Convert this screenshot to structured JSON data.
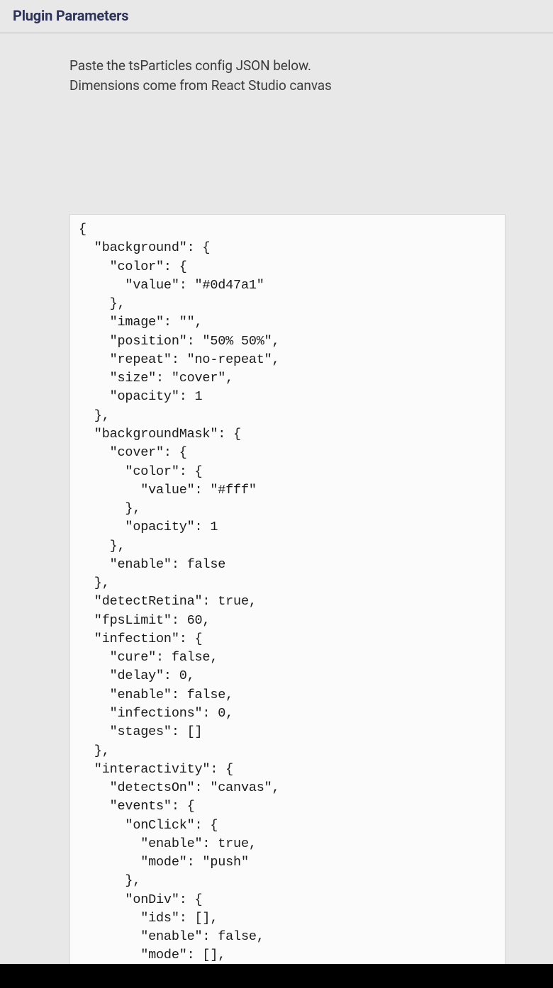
{
  "header": {
    "title": "Plugin Parameters"
  },
  "instructions": {
    "line1": "Paste the tsParticles config JSON below.",
    "line2": "Dimensions come from React Studio canvas"
  },
  "configJson": "{\n  \"background\": {\n    \"color\": {\n      \"value\": \"#0d47a1\"\n    },\n    \"image\": \"\",\n    \"position\": \"50% 50%\",\n    \"repeat\": \"no-repeat\",\n    \"size\": \"cover\",\n    \"opacity\": 1\n  },\n  \"backgroundMask\": {\n    \"cover\": {\n      \"color\": {\n        \"value\": \"#fff\"\n      },\n      \"opacity\": 1\n    },\n    \"enable\": false\n  },\n  \"detectRetina\": true,\n  \"fpsLimit\": 60,\n  \"infection\": {\n    \"cure\": false,\n    \"delay\": 0,\n    \"enable\": false,\n    \"infections\": 0,\n    \"stages\": []\n  },\n  \"interactivity\": {\n    \"detectsOn\": \"canvas\",\n    \"events\": {\n      \"onClick\": {\n        \"enable\": true,\n        \"mode\": \"push\"\n      },\n      \"onDiv\": {\n        \"ids\": [],\n        \"enable\": false,\n        \"mode\": [],\n        \"type\": \"circle\""
}
